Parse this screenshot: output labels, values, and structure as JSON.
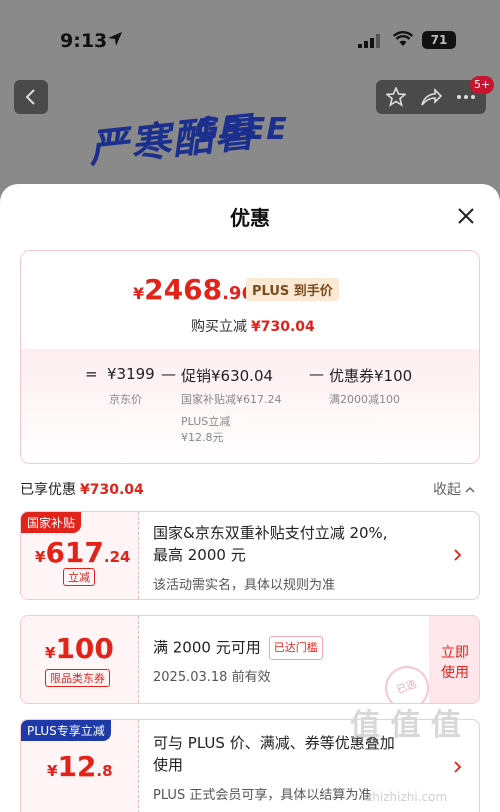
{
  "status_bar": {
    "time": "9:13",
    "battery": "71"
  },
  "background": {
    "brand": "GREE",
    "slogan": "严寒酷暑",
    "notifications": "5+"
  },
  "sheet": {
    "title": "优惠",
    "summary": {
      "price_symbol": "¥",
      "price_int": "2468",
      "price_dec": ".96",
      "plus_tag": "PLUS 到手价",
      "reduce_label": "购买立减",
      "reduce_value": "¥730.04",
      "formula": {
        "eq": "=",
        "base": "¥3199",
        "base_label": "京东价",
        "minus1": "—",
        "promo": "促销¥630.04",
        "promo_sub1": "国家补贴减¥617.24",
        "promo_sub2": "PLUS立减",
        "promo_sub3": "¥12.8元",
        "minus2": "—",
        "coupon": "优惠券¥100",
        "coupon_sub": "满2000减100"
      }
    },
    "applied": {
      "label": "已享优惠",
      "value": "¥730.04",
      "collapse": "收起"
    },
    "coupons": [
      {
        "tag": "国家补贴",
        "symbol": "¥",
        "amount": "617",
        "decimal": ".24",
        "badge": "立减",
        "title_line1": "国家&京东双重补贴支付立减 20%,",
        "title_line2": "最高 2000 元",
        "sub": "该活动需实名，具体以规则为准"
      },
      {
        "symbol": "¥",
        "amount": "100",
        "badge": "限品类东券",
        "title": "满 2000 元可用",
        "reached": "已达门槛",
        "sub": "2025.03.18 前有效",
        "action_line1": "立即",
        "action_line2": "使用",
        "stamp": "已选"
      },
      {
        "tag": "PLUS专享立减",
        "symbol": "¥",
        "amount": "12",
        "decimal": ".8",
        "title_line1": "可与 PLUS 价、满减、券等优惠叠加",
        "title_line2": "使用",
        "sub": "PLUS 正式会员可享，具体以结算为准"
      }
    ]
  },
  "watermark": {
    "text": "值 值 值",
    "url": "zhizhizhi.com"
  },
  "colors": {
    "accent": "#e2231a",
    "plus_tag_bg": "#fbe9d4",
    "subsidy_tag": "#e2231a",
    "plus_tag": "#1e3aa8"
  }
}
